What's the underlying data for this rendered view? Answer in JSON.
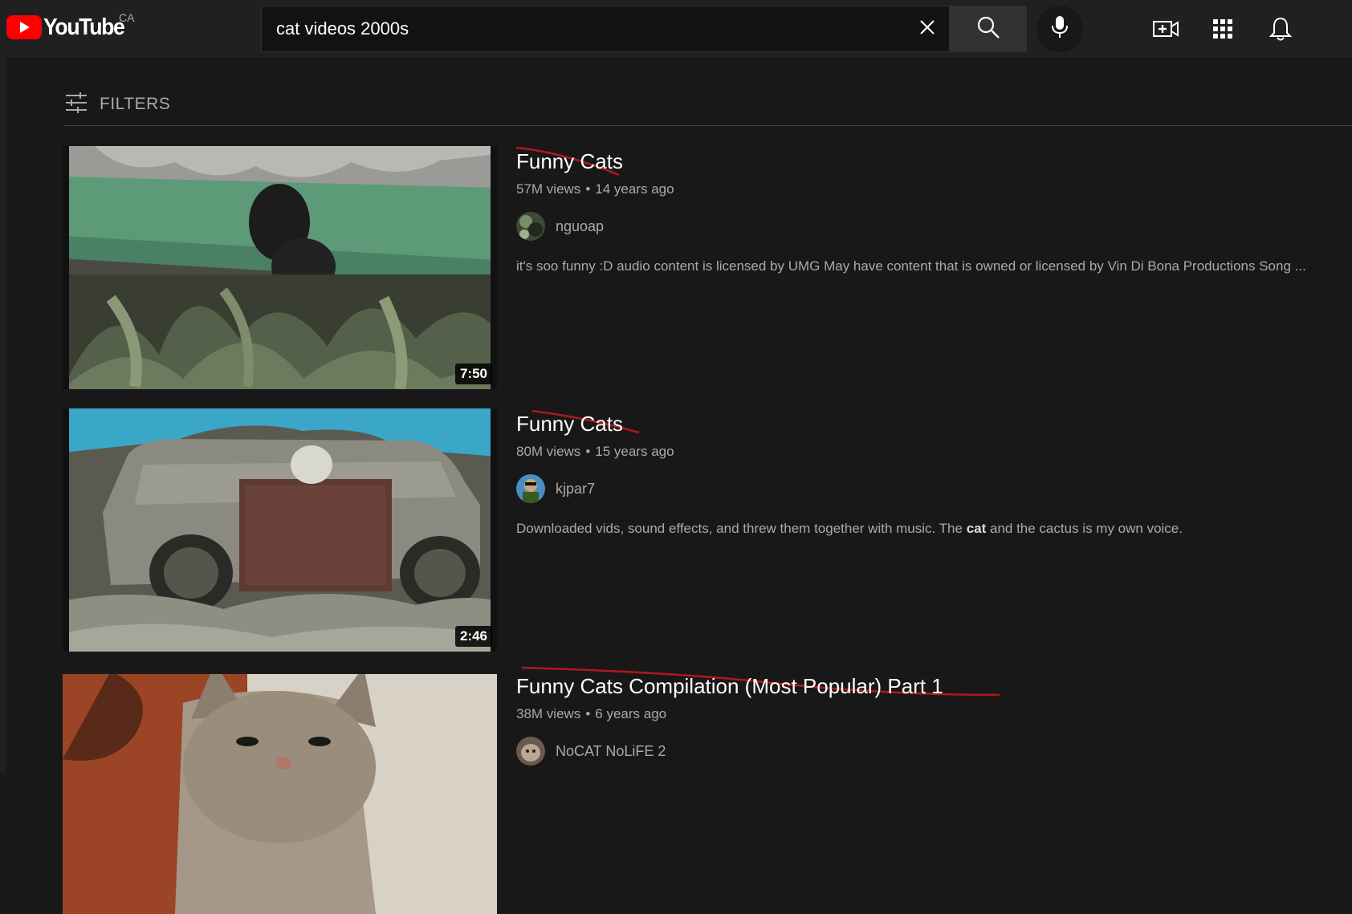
{
  "header": {
    "logo_text": "YouTube",
    "region": "CA",
    "search": {
      "value": "cat videos 2000s",
      "placeholder": "Search"
    },
    "icons": [
      "youtube-logo-icon",
      "close-icon",
      "search-icon",
      "mic-icon",
      "create-video-icon",
      "apps-grid-icon",
      "bell-icon"
    ]
  },
  "filters": {
    "label": "FILTERS"
  },
  "results": [
    {
      "title": "Funny Cats",
      "views": "57M views",
      "age": "14 years ago",
      "channel": "nguoap",
      "description": "it's soo funny :D audio content is licensed by UMG May have content that is owned or licensed by Vin Di Bona Productions Song ...",
      "duration": "7:50"
    },
    {
      "title": "Funny Cats",
      "views": "80M views",
      "age": "15 years ago",
      "channel": "kjpar7",
      "description_pre": "Downloaded vids, sound effects, and threw them together with music. The ",
      "description_bold": "cat",
      "description_post": " and the cactus is my own voice.",
      "duration": "2:46"
    },
    {
      "title": "Funny Cats Compilation (Most Popular) Part 1",
      "views": "38M views",
      "age": "6 years ago",
      "channel": "NoCAT NoLiFE 2"
    }
  ],
  "colors": {
    "background": "#181818",
    "header": "#202020",
    "brand_red": "#ff0000",
    "annotation_red": "#b0181c",
    "text_secondary": "#aaaaaa"
  }
}
